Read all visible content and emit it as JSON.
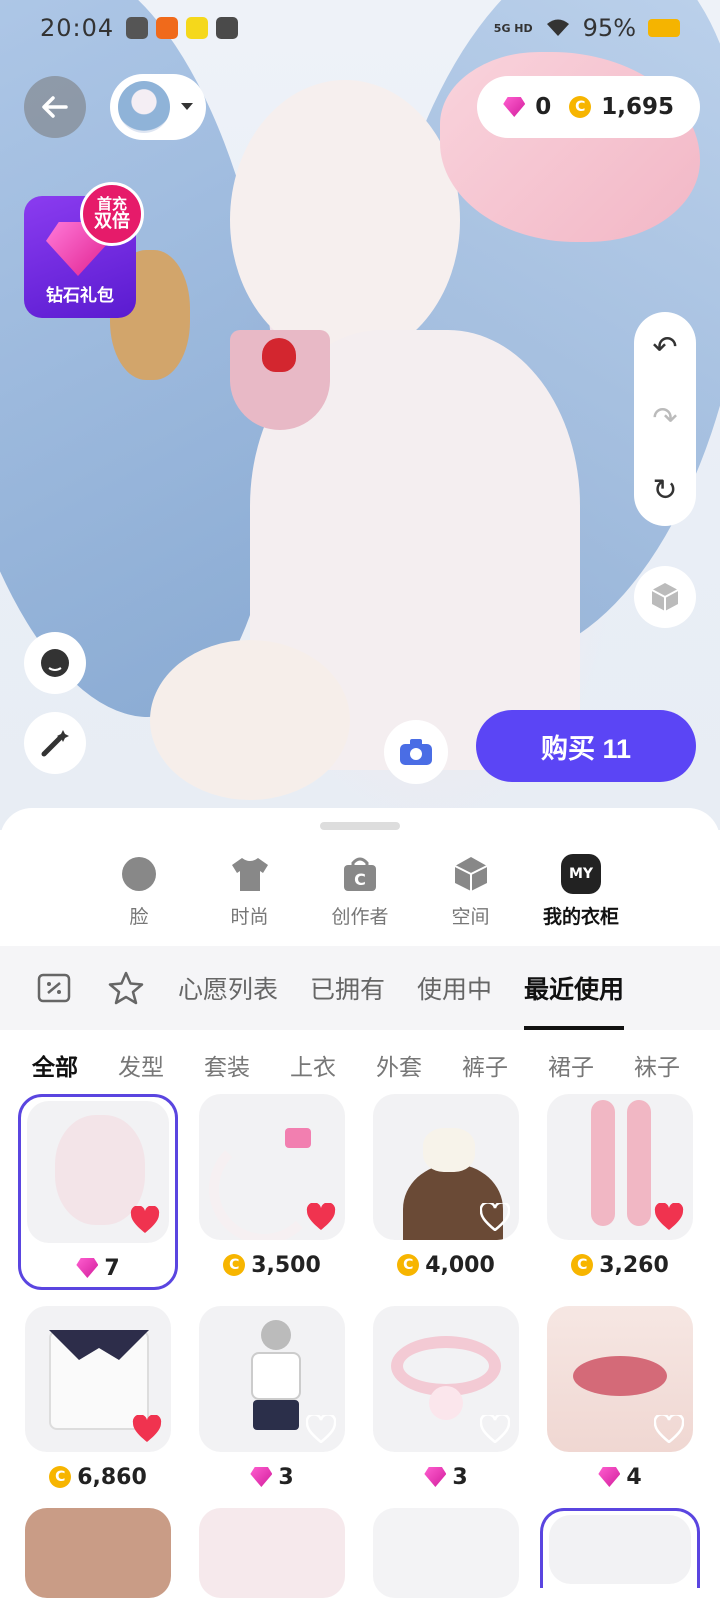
{
  "status_bar": {
    "time": "20:04",
    "network": "5G HD",
    "battery": "95%"
  },
  "currency": {
    "gems": "0",
    "coins": "1,695"
  },
  "gift": {
    "label": "钻石礼包",
    "badge_line1": "首充",
    "badge_line2": "双倍"
  },
  "buy_button": {
    "label": "购买 11"
  },
  "categories": [
    {
      "label": "脸"
    },
    {
      "label": "时尚"
    },
    {
      "label": "创作者"
    },
    {
      "label": "空间"
    },
    {
      "label": "我的衣柜",
      "icon_text": "MY"
    }
  ],
  "subtabs": [
    "心愿列表",
    "已拥有",
    "使用中",
    "最近使用"
  ],
  "filters": [
    "全部",
    "发型",
    "套装",
    "上衣",
    "外套",
    "裤子",
    "裙子",
    "袜子"
  ],
  "items": [
    {
      "price": "7",
      "currency": "gem",
      "favorited": true,
      "selected": true
    },
    {
      "price": "3,500",
      "currency": "coin",
      "favorited": true
    },
    {
      "price": "4,000",
      "currency": "coin",
      "favorited": false
    },
    {
      "price": "3,260",
      "currency": "coin",
      "favorited": true
    },
    {
      "price": "6,860",
      "currency": "coin",
      "favorited": true
    },
    {
      "price": "3",
      "currency": "gem",
      "favorited": false
    },
    {
      "price": "3",
      "currency": "gem",
      "favorited": false
    },
    {
      "price": "4",
      "currency": "gem",
      "favorited": false
    }
  ],
  "colors": {
    "accent": "#5b45f5",
    "heart": "#f0334f",
    "gem": "#e0208e",
    "coin": "#f7b500"
  }
}
